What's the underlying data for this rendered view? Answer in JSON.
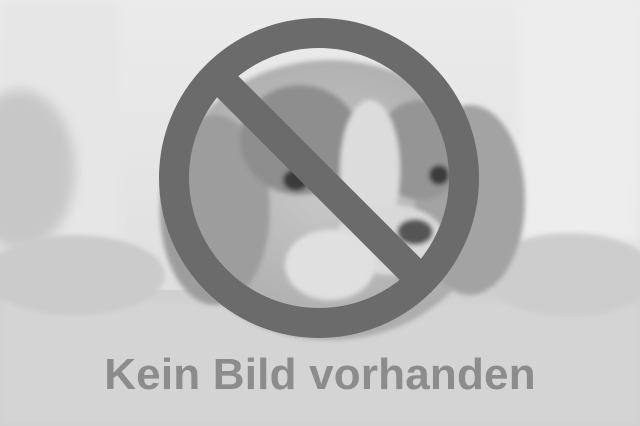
{
  "placeholder": {
    "caption": "Kein Bild vorhanden",
    "icon": "no-entry-icon",
    "icon_color": "#6b6b6b",
    "caption_color": "#8c8c8c",
    "photo_subject": "dog"
  }
}
